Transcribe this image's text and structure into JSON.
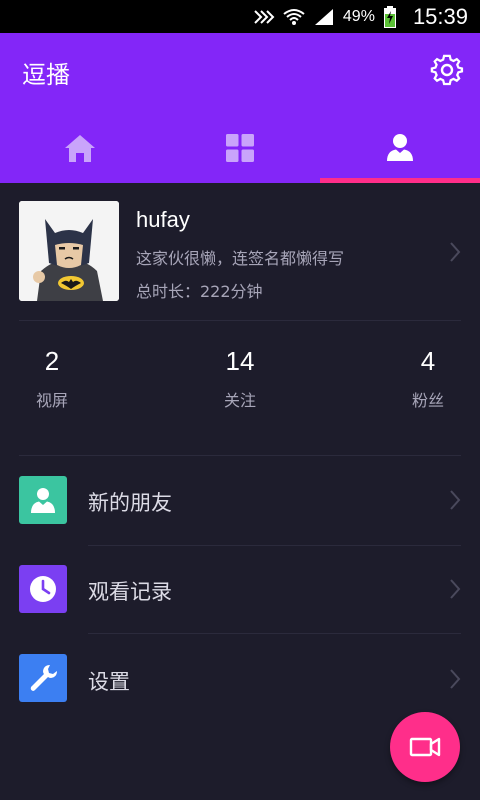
{
  "status_bar": {
    "battery_percent": "49%",
    "time": "15:39",
    "icons": [
      "nfc-icon",
      "wifi-icon",
      "signal-icon",
      "battery-charging-icon"
    ]
  },
  "app_bar": {
    "title": "逗播",
    "settings_icon": "gear-icon"
  },
  "tabs": [
    {
      "name": "home",
      "icon": "home-icon",
      "selected": false
    },
    {
      "name": "discover",
      "icon": "grid-icon",
      "selected": false
    },
    {
      "name": "profile",
      "icon": "person-icon",
      "selected": true
    }
  ],
  "colors": {
    "primary": "#8326f8",
    "accent": "#ff2e8a",
    "background": "#1d1c2b",
    "friends_icon_bg": "#3bc5a0",
    "history_icon_bg": "#7b3ff2",
    "settings_icon_bg": "#3c7ff2"
  },
  "profile": {
    "username": "hufay",
    "bio": "这家伙很懒，连签名都懒得写",
    "duration": "总时长：222分钟",
    "avatar_icon": "batman-avatar"
  },
  "stats": [
    {
      "value": "2",
      "label": "视屏"
    },
    {
      "value": "14",
      "label": "关注"
    },
    {
      "value": "4",
      "label": "粉丝"
    }
  ],
  "menu": [
    {
      "label": "新的朋友",
      "icon": "person-icon"
    },
    {
      "label": "观看记录",
      "icon": "clock-icon"
    },
    {
      "label": "设置",
      "icon": "wrench-icon"
    }
  ],
  "fab": {
    "icon": "video-camera-icon"
  }
}
